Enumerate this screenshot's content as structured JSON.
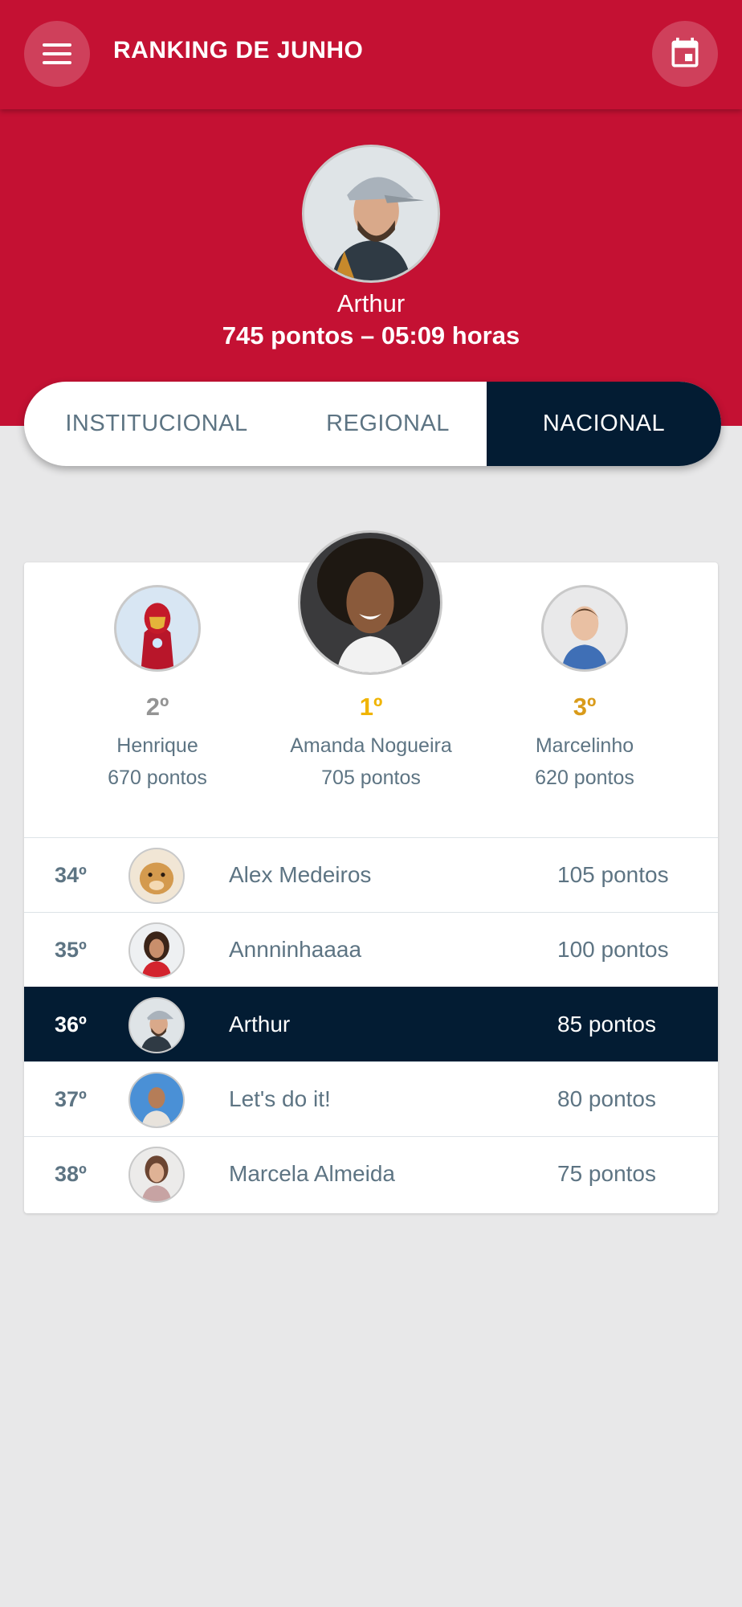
{
  "header": {
    "title": "RANKING DE JUNHO",
    "menu_icon": "menu-icon",
    "calendar_icon": "calendar-icon"
  },
  "user": {
    "name": "Arthur",
    "stats": "745 pontos – 05:09 horas"
  },
  "tabs": [
    {
      "label": "INSTITUCIONAL",
      "active": false
    },
    {
      "label": "REGIONAL",
      "active": false
    },
    {
      "label": "NACIONAL",
      "active": true
    }
  ],
  "podium": {
    "first": {
      "position": "1º",
      "name": "Amanda Nogueira",
      "points": "705 pontos"
    },
    "second": {
      "position": "2º",
      "name": "Henrique",
      "points": "670 pontos"
    },
    "third": {
      "position": "3º",
      "name": "Marcelinho",
      "points": "620 pontos"
    }
  },
  "ranking": [
    {
      "position": "34º",
      "name": "Alex Medeiros",
      "points": "105 pontos",
      "current": false
    },
    {
      "position": "35º",
      "name": "Annninhaaaa",
      "points": "100 pontos",
      "current": false
    },
    {
      "position": "36º",
      "name": "Arthur",
      "points": "85 pontos",
      "current": true
    },
    {
      "position": "37º",
      "name": "Let's do it!",
      "points": "80 pontos",
      "current": false
    },
    {
      "position": "38º",
      "name": "Marcela Almeida",
      "points": "75 pontos",
      "current": false
    }
  ],
  "colors": {
    "primary": "#c41133",
    "dark": "#031c33",
    "text": "#5d7483",
    "gold": "#f0b400",
    "silver": "#949494",
    "bronze": "#d99b1a",
    "background": "#e8e8e9"
  }
}
